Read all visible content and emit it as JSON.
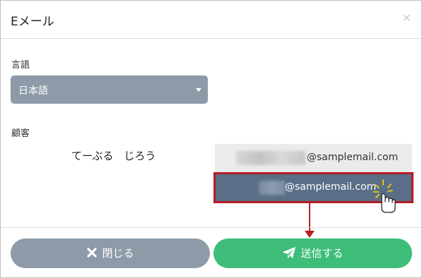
{
  "dialog": {
    "title": "Eメール",
    "close_glyph": "×"
  },
  "language": {
    "label": "言語",
    "selected": "日本語"
  },
  "customer": {
    "label": "顧客",
    "name": "てーぶる　じろう",
    "emails": [
      {
        "address": "@samplemail.com",
        "selected": false
      },
      {
        "address": "@samplemail.com",
        "selected": true
      }
    ]
  },
  "buttons": {
    "close_label": "閉じる",
    "send_label": "送信する"
  },
  "colors": {
    "select_bg": "#8c9ba7",
    "selected_option_bg": "#5a6e88",
    "highlight_border": "#b51c22",
    "send_button": "#3dbd79"
  },
  "icons": {
    "close_button_icon": "x-icon",
    "send_button_icon": "paper-plane-icon",
    "cursor": "pointer-hand-icon"
  }
}
